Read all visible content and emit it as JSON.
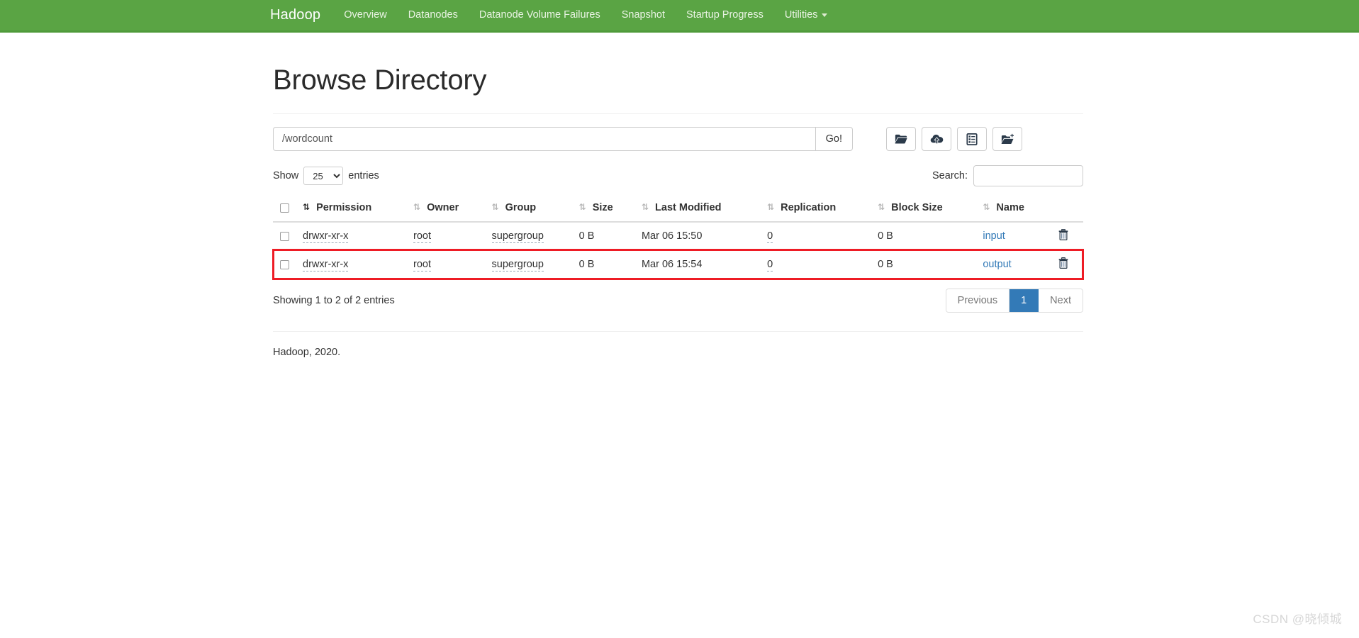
{
  "navbar": {
    "brand": "Hadoop",
    "background_color": "#5aa444",
    "items": [
      {
        "label": "Overview",
        "icon": ""
      },
      {
        "label": "Datanodes",
        "icon": ""
      },
      {
        "label": "Datanode Volume Failures",
        "icon": ""
      },
      {
        "label": "Snapshot",
        "icon": ""
      },
      {
        "label": "Startup Progress",
        "icon": ""
      },
      {
        "label": "Utilities",
        "icon": "caret-down-icon"
      }
    ]
  },
  "page": {
    "title": "Browse Directory",
    "footer": "Hadoop, 2020."
  },
  "pathbar": {
    "value": "/wordcount",
    "placeholder": "Enter directory path",
    "go_label": "Go!",
    "buttons": [
      {
        "name": "open-folder-icon",
        "title": "Browse"
      },
      {
        "name": "cloud-upload-icon",
        "title": "Upload Files"
      },
      {
        "name": "clipboard-list-icon",
        "title": "Snapshot"
      },
      {
        "name": "new-folder-icon",
        "title": "Create Directory"
      }
    ]
  },
  "controls": {
    "show_label": "Show",
    "entries_label": "entries",
    "page_length": "25",
    "page_length_options": [
      "25",
      "50",
      "100"
    ],
    "search_label": "Search:",
    "search_value": "",
    "search_placeholder": ""
  },
  "table": {
    "columns": [
      {
        "label": "",
        "sort": "none"
      },
      {
        "label": "Permission",
        "sort": "asc-active"
      },
      {
        "label": "Owner",
        "sort": "both"
      },
      {
        "label": "Group",
        "sort": "both"
      },
      {
        "label": "Size",
        "sort": "both"
      },
      {
        "label": "Last Modified",
        "sort": "both"
      },
      {
        "label": "Replication",
        "sort": "both"
      },
      {
        "label": "Block Size",
        "sort": "both"
      },
      {
        "label": "Name",
        "sort": "both"
      }
    ],
    "rows": [
      {
        "permission": "drwxr-xr-x",
        "owner": "root",
        "group": "supergroup",
        "size": "0 B",
        "last_modified": "Mar 06 15:50",
        "replication": "0",
        "block_size": "0 B",
        "name": "input",
        "delete_icon": "trash-icon",
        "highlighted": false
      },
      {
        "permission": "drwxr-xr-x",
        "owner": "root",
        "group": "supergroup",
        "size": "0 B",
        "last_modified": "Mar 06 15:54",
        "replication": "0",
        "block_size": "0 B",
        "name": "output",
        "delete_icon": "trash-icon",
        "highlighted": true
      }
    ]
  },
  "pagination": {
    "info": "Showing 1 to 2 of 2 entries",
    "previous_label": "Previous",
    "next_label": "Next",
    "current_page": "1",
    "active_color": "#337ab7"
  },
  "annotation": {
    "highlight_color": "#ee1c25",
    "target_row_name": "output"
  },
  "watermark": "CSDN @晓倾城"
}
